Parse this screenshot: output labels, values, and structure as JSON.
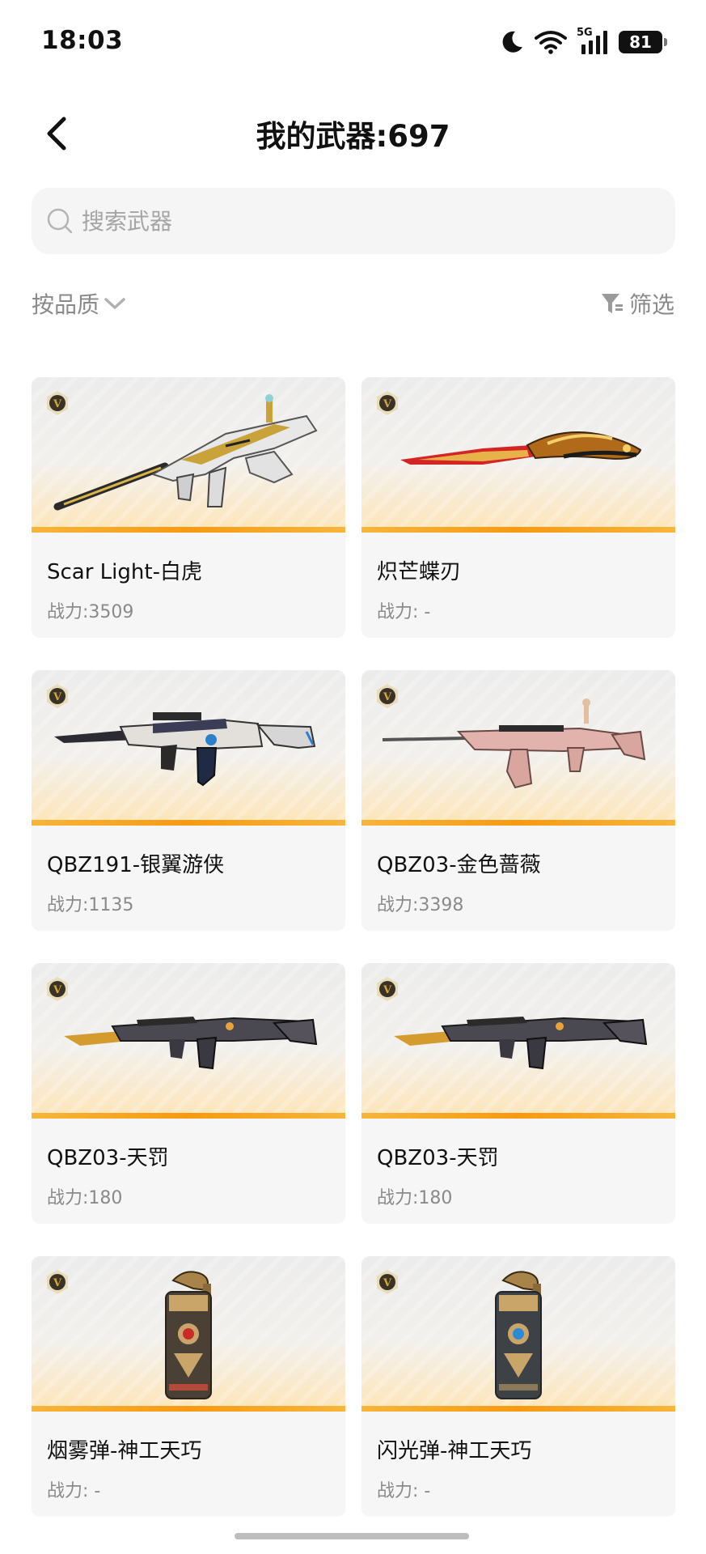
{
  "status_bar": {
    "time": "18:03",
    "network": "5G",
    "battery": "81"
  },
  "header": {
    "title": "我的武器:697"
  },
  "search": {
    "placeholder": "搜索武器",
    "value": ""
  },
  "toolbar": {
    "sort_label": "按品质",
    "filter_label": "筛选"
  },
  "colors": {
    "badge_gold": "#d3a53a",
    "card_bar": "#f79a12",
    "card_bg": "#f6f6f6"
  },
  "power_prefix": "战力:",
  "weapons": [
    {
      "name": "Scar Light-白虎",
      "power": "战力:3509",
      "tier_icon": "v-tier-badge-icon",
      "art": "rifle-white-gold"
    },
    {
      "name": "炽芒蝶刃",
      "power": "战力: -",
      "tier_icon": "v-tier-badge-icon",
      "art": "butterfly-knife-red-gold"
    },
    {
      "name": "QBZ191-银翼游侠",
      "power": "战力:1135",
      "tier_icon": "v-tier-badge-icon",
      "art": "rifle-silver-dark"
    },
    {
      "name": "QBZ03-金色蔷薇",
      "power": "战力:3398",
      "tier_icon": "v-tier-badge-icon",
      "art": "rifle-pink-rose"
    },
    {
      "name": "QBZ03-天罚",
      "power": "战力:180",
      "tier_icon": "v-tier-badge-icon",
      "art": "rifle-dark-gold"
    },
    {
      "name": "QBZ03-天罚",
      "power": "战力:180",
      "tier_icon": "v-tier-badge-icon",
      "art": "rifle-dark-gold"
    },
    {
      "name": "烟雾弹-神工天巧",
      "power": "战力: -",
      "tier_icon": "v-tier-badge-icon",
      "art": "grenade-dragon-red"
    },
    {
      "name": "闪光弹-神工天巧",
      "power": "战力: -",
      "tier_icon": "v-tier-badge-icon",
      "art": "grenade-dragon-blue"
    }
  ]
}
